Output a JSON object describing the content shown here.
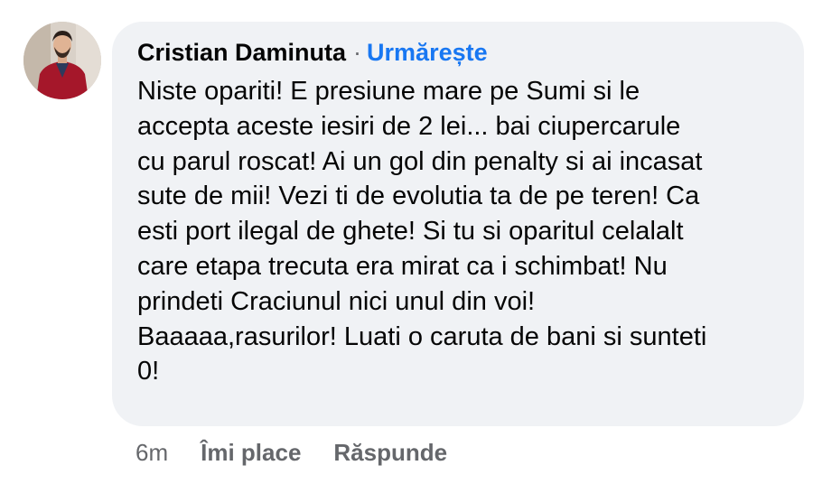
{
  "comment": {
    "author": "Cristian Daminuta",
    "separator": "·",
    "follow_label": "Urmărește",
    "text": "Niste opariti! E presiune mare pe Sumi si le\naccepta aceste iesiri de 2 lei... bai ciupercarule\ncu parul roscat! Ai un gol din penalty si ai incasat\nsute de mii! Vezi ti de evolutia ta de pe teren! Ca\nesti port ilegal de ghete! Si tu si oparitul celalalt\ncare etapa trecuta era mirat ca i schimbat! Nu\nprindeti Craciunul nici unul din voi!\nBaaaaa,rasurilor! Luati o caruta de bani si sunteti\n0!",
    "avatar_icon": "profile-photo"
  },
  "actions": {
    "time": "6m",
    "like_label": "Îmi place",
    "reply_label": "Răspunde"
  },
  "colors": {
    "bubble_bg": "#f0f2f5",
    "link_blue": "#1877f2",
    "meta_gray": "#65676b",
    "text_black": "#050505"
  }
}
